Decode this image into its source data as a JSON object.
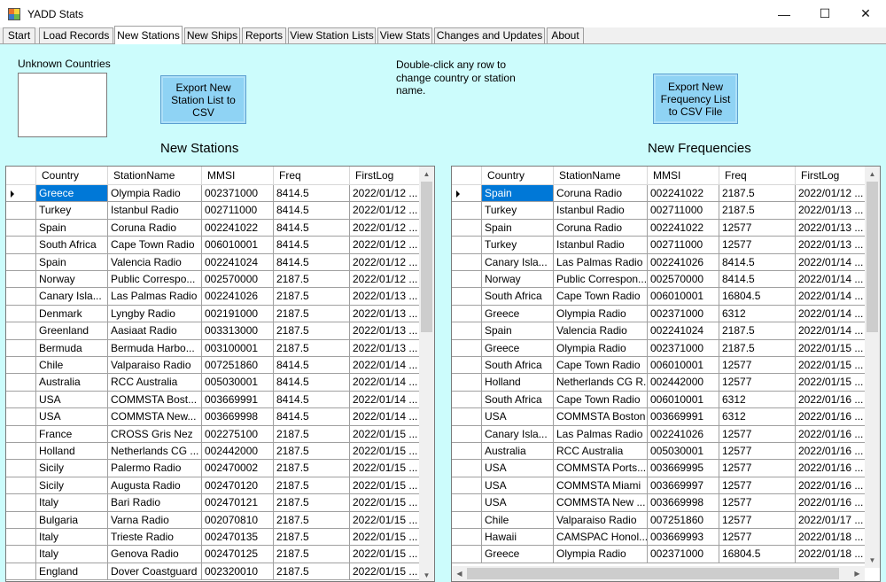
{
  "window": {
    "title": "YADD Stats",
    "minimize": "—",
    "maximize": "☐",
    "close": "✕"
  },
  "tabs": [
    {
      "label": "Start",
      "active": false
    },
    {
      "label": "Load Records",
      "active": false
    },
    {
      "label": "New Stations",
      "active": true
    },
    {
      "label": "New Ships",
      "active": false
    },
    {
      "label": "Reports",
      "active": false
    },
    {
      "label": "View Station Lists",
      "active": false
    },
    {
      "label": "View Stats",
      "active": false
    },
    {
      "label": "Changes and Updates",
      "active": false
    },
    {
      "label": "About",
      "active": false
    }
  ],
  "unknown_countries_label": "Unknown Countries",
  "export_stations_button": "Export New Station List to CSV",
  "hint_text": "Double-click any row to change country or station name.",
  "export_freq_button": "Export New Frequency List to CSV File",
  "stations_heading": "New Stations",
  "freq_heading": "New Frequencies",
  "columns": [
    "Country",
    "StationName",
    "MMSI",
    "Freq",
    "FirstLog"
  ],
  "stations_rows": [
    [
      "Greece",
      "Olympia Radio",
      "002371000",
      "8414.5",
      "2022/01/12 ..."
    ],
    [
      "Turkey",
      "Istanbul Radio",
      "002711000",
      "8414.5",
      "2022/01/12 ..."
    ],
    [
      "Spain",
      "Coruna Radio",
      "002241022",
      "8414.5",
      "2022/01/12 ..."
    ],
    [
      "South Africa",
      "Cape Town Radio",
      "006010001",
      "8414.5",
      "2022/01/12 ..."
    ],
    [
      "Spain",
      "Valencia Radio",
      "002241024",
      "8414.5",
      "2022/01/12 ..."
    ],
    [
      "Norway",
      "Public Correspo...",
      "002570000",
      "2187.5",
      "2022/01/12 ..."
    ],
    [
      "Canary Isla...",
      "Las Palmas Radio",
      "002241026",
      "2187.5",
      "2022/01/13 ..."
    ],
    [
      "Denmark",
      "Lyngby Radio",
      "002191000",
      "2187.5",
      "2022/01/13 ..."
    ],
    [
      "Greenland",
      "Aasiaat Radio",
      "003313000",
      "2187.5",
      "2022/01/13 ..."
    ],
    [
      "Bermuda",
      "Bermuda Harbo...",
      "003100001",
      "2187.5",
      "2022/01/13 ..."
    ],
    [
      "Chile",
      "Valparaiso Radio",
      "007251860",
      "8414.5",
      "2022/01/14 ..."
    ],
    [
      "Australia",
      "RCC Australia",
      "005030001",
      "8414.5",
      "2022/01/14 ..."
    ],
    [
      "USA",
      "COMMSTA Bost...",
      "003669991",
      "8414.5",
      "2022/01/14 ..."
    ],
    [
      "USA",
      "COMMSTA New...",
      "003669998",
      "8414.5",
      "2022/01/14 ..."
    ],
    [
      "France",
      "CROSS Gris Nez",
      "002275100",
      "2187.5",
      "2022/01/15 ..."
    ],
    [
      "Holland",
      "Netherlands CG ...",
      "002442000",
      "2187.5",
      "2022/01/15 ..."
    ],
    [
      "Sicily",
      "Palermo Radio",
      "002470002",
      "2187.5",
      "2022/01/15 ..."
    ],
    [
      "Sicily",
      "Augusta Radio",
      "002470120",
      "2187.5",
      "2022/01/15 ..."
    ],
    [
      "Italy",
      "Bari Radio",
      "002470121",
      "2187.5",
      "2022/01/15 ..."
    ],
    [
      "Bulgaria",
      "Varna Radio",
      "002070810",
      "2187.5",
      "2022/01/15 ..."
    ],
    [
      "Italy",
      "Trieste Radio",
      "002470135",
      "2187.5",
      "2022/01/15 ..."
    ],
    [
      "Italy",
      "Genova Radio",
      "002470125",
      "2187.5",
      "2022/01/15 ..."
    ],
    [
      "England",
      "Dover Coastguard",
      "002320010",
      "2187.5",
      "2022/01/15 ..."
    ]
  ],
  "freq_rows": [
    [
      "Spain",
      "Coruna Radio",
      "002241022",
      "2187.5",
      "2022/01/12 ..."
    ],
    [
      "Turkey",
      "Istanbul Radio",
      "002711000",
      "2187.5",
      "2022/01/13 ..."
    ],
    [
      "Spain",
      "Coruna Radio",
      "002241022",
      "12577",
      "2022/01/13 ..."
    ],
    [
      "Turkey",
      "Istanbul Radio",
      "002711000",
      "12577",
      "2022/01/13 ..."
    ],
    [
      "Canary Isla...",
      "Las Palmas Radio",
      "002241026",
      "8414.5",
      "2022/01/14 ..."
    ],
    [
      "Norway",
      "Public Correspon...",
      "002570000",
      "8414.5",
      "2022/01/14 ..."
    ],
    [
      "South Africa",
      "Cape Town Radio",
      "006010001",
      "16804.5",
      "2022/01/14 ..."
    ],
    [
      "Greece",
      "Olympia Radio",
      "002371000",
      "6312",
      "2022/01/14 ..."
    ],
    [
      "Spain",
      "Valencia Radio",
      "002241024",
      "2187.5",
      "2022/01/14 ..."
    ],
    [
      "Greece",
      "Olympia Radio",
      "002371000",
      "2187.5",
      "2022/01/15 ..."
    ],
    [
      "South Africa",
      "Cape Town Radio",
      "006010001",
      "12577",
      "2022/01/15 ..."
    ],
    [
      "Holland",
      "Netherlands CG R...",
      "002442000",
      "12577",
      "2022/01/15 ..."
    ],
    [
      "South Africa",
      "Cape Town Radio",
      "006010001",
      "6312",
      "2022/01/16 ..."
    ],
    [
      "USA",
      "COMMSTA Boston",
      "003669991",
      "6312",
      "2022/01/16 ..."
    ],
    [
      "Canary Isla...",
      "Las Palmas Radio",
      "002241026",
      "12577",
      "2022/01/16 ..."
    ],
    [
      "Australia",
      "RCC Australia",
      "005030001",
      "12577",
      "2022/01/16 ..."
    ],
    [
      "USA",
      "COMMSTA Ports...",
      "003669995",
      "12577",
      "2022/01/16 ..."
    ],
    [
      "USA",
      "COMMSTA Miami",
      "003669997",
      "12577",
      "2022/01/16 ..."
    ],
    [
      "USA",
      "COMMSTA New ...",
      "003669998",
      "12577",
      "2022/01/16 ..."
    ],
    [
      "Chile",
      "Valparaiso Radio",
      "007251860",
      "12577",
      "2022/01/17 ..."
    ],
    [
      "Hawaii",
      "CAMSPAC Honol...",
      "003669993",
      "12577",
      "2022/01/18 ..."
    ],
    [
      "Greece",
      "Olympia Radio",
      "002371000",
      "16804.5",
      "2022/01/18 ..."
    ]
  ],
  "colors": {
    "panel_bg": "#ccfcfc",
    "button_bg": "#8fd3f4",
    "selection": "#0078d7"
  }
}
